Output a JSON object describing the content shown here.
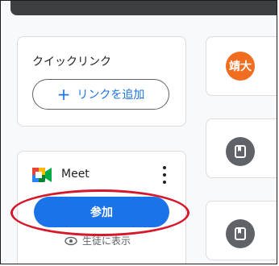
{
  "quick_links": {
    "title": "クイックリンク",
    "add_button_icon": "plus-icon",
    "add_button_label": "リンクを追加"
  },
  "meet": {
    "label": "Meet",
    "join_label": "参加",
    "visibility_label": "生徒に表示",
    "visibility_icon": "eye-icon"
  },
  "stream": {
    "posts": [
      {
        "avatar_text": "靖大",
        "avatar_color": "#f16d20"
      },
      {
        "icon": "assignment-icon"
      },
      {
        "icon": "assignment-icon"
      }
    ]
  },
  "colors": {
    "accent": "#1a73e8",
    "annotation": "#d6182a"
  }
}
